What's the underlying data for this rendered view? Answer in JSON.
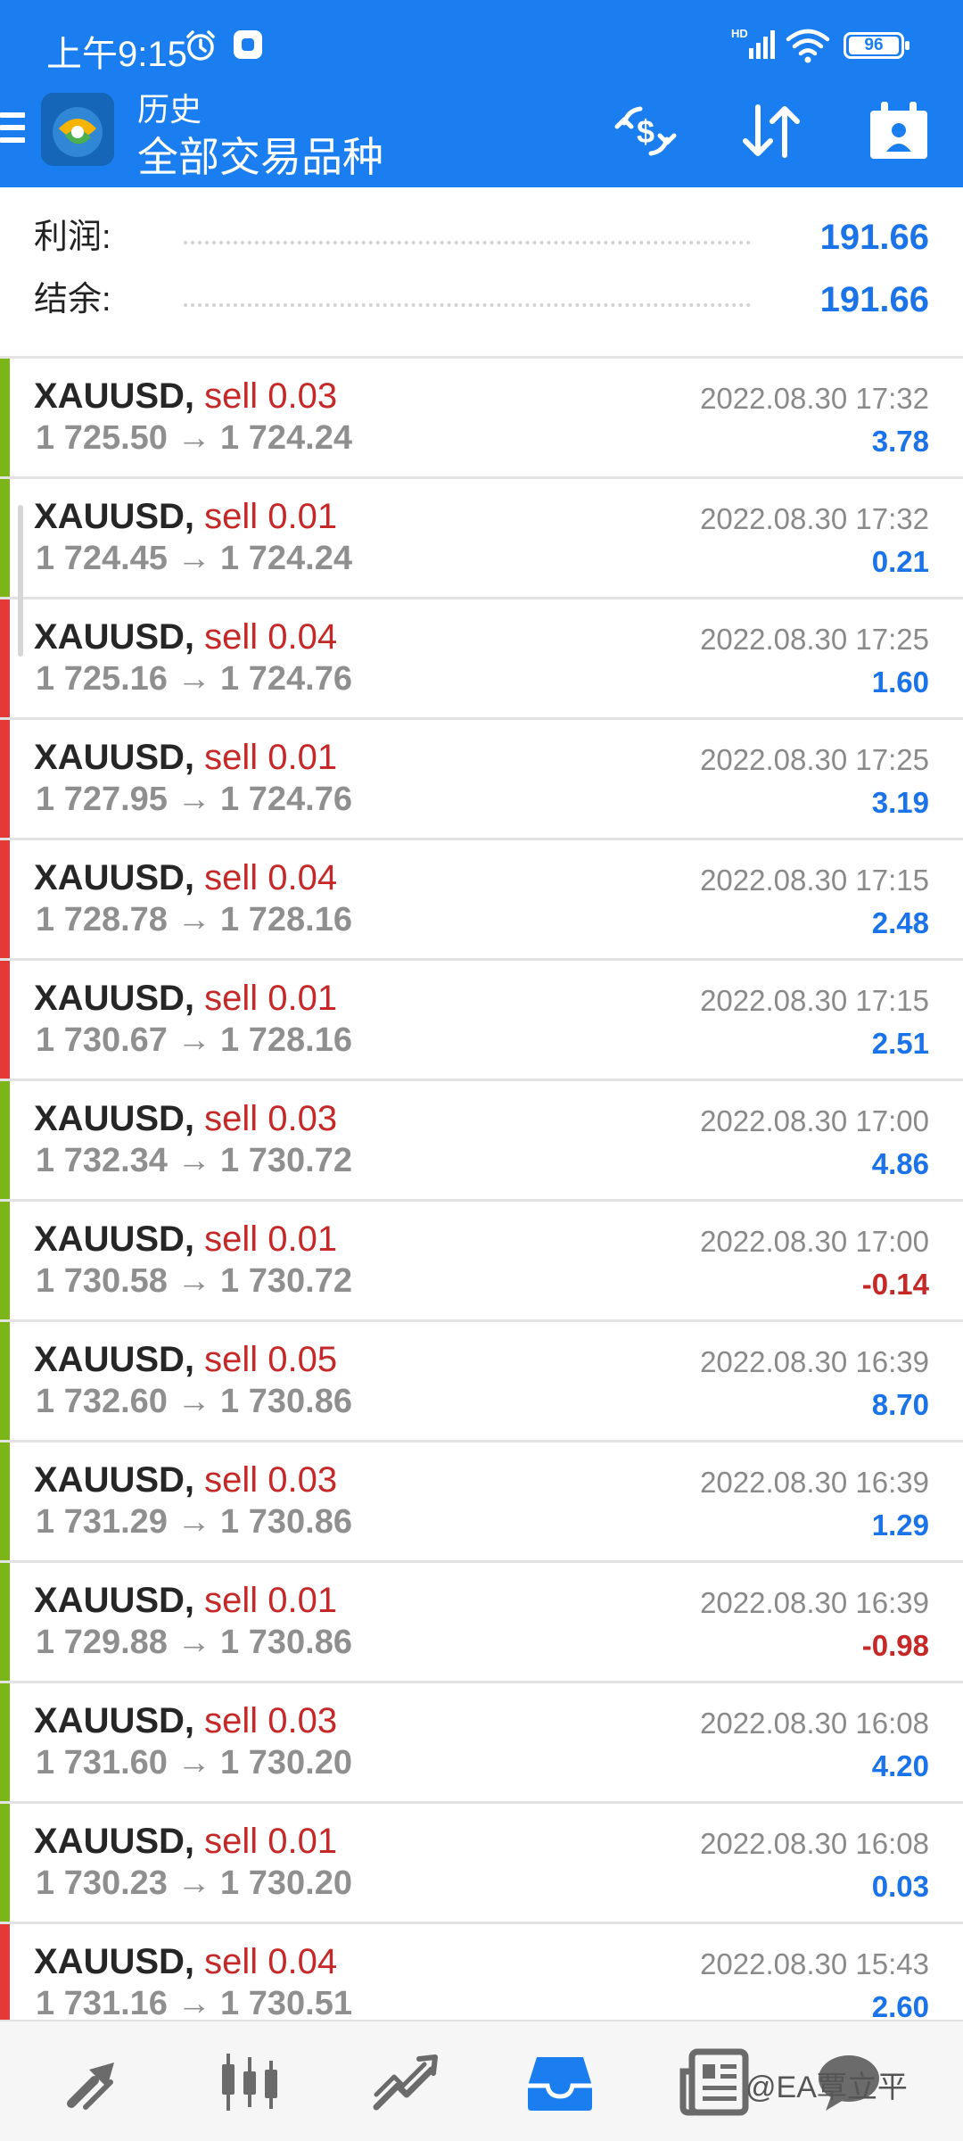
{
  "status_bar": {
    "time": "上午9:15",
    "network": "HD",
    "battery": "96"
  },
  "app_bar": {
    "title_small": "历史",
    "title_big": "全部交易品种",
    "icons": [
      "menu-icon",
      "app-logo",
      "currency-exchange-icon",
      "sort-icon",
      "calendar-icon"
    ]
  },
  "summary": {
    "profit_label": "利润:",
    "profit_value": "191.66",
    "balance_label": "结余:",
    "balance_value": "191.66"
  },
  "colors": {
    "header": "#1a7ef0",
    "positive": "#1a73e8",
    "negative": "#c62828",
    "sell": "#c62828",
    "bar_green": "#7cb518",
    "bar_red": "#e53935"
  },
  "trades": [
    {
      "symbol": "XAUUSD,",
      "side": "sell 0.03",
      "open": "1 725.50",
      "arrow": "→",
      "close": "1 724.24",
      "time": "2022.08.30 17:32",
      "profit": "3.78",
      "bar": "green",
      "negative": false
    },
    {
      "symbol": "XAUUSD,",
      "side": "sell 0.01",
      "open": "1 724.45",
      "arrow": "→",
      "close": "1 724.24",
      "time": "2022.08.30 17:32",
      "profit": "0.21",
      "bar": "green",
      "negative": false
    },
    {
      "symbol": "XAUUSD,",
      "side": "sell 0.04",
      "open": "1 725.16",
      "arrow": "→",
      "close": "1 724.76",
      "time": "2022.08.30 17:25",
      "profit": "1.60",
      "bar": "red",
      "negative": false
    },
    {
      "symbol": "XAUUSD,",
      "side": "sell 0.01",
      "open": "1 727.95",
      "arrow": "→",
      "close": "1 724.76",
      "time": "2022.08.30 17:25",
      "profit": "3.19",
      "bar": "red",
      "negative": false
    },
    {
      "symbol": "XAUUSD,",
      "side": "sell 0.04",
      "open": "1 728.78",
      "arrow": "→",
      "close": "1 728.16",
      "time": "2022.08.30 17:15",
      "profit": "2.48",
      "bar": "red",
      "negative": false
    },
    {
      "symbol": "XAUUSD,",
      "side": "sell 0.01",
      "open": "1 730.67",
      "arrow": "→",
      "close": "1 728.16",
      "time": "2022.08.30 17:15",
      "profit": "2.51",
      "bar": "red",
      "negative": false
    },
    {
      "symbol": "XAUUSD,",
      "side": "sell 0.03",
      "open": "1 732.34",
      "arrow": "→",
      "close": "1 730.72",
      "time": "2022.08.30 17:00",
      "profit": "4.86",
      "bar": "green",
      "negative": false
    },
    {
      "symbol": "XAUUSD,",
      "side": "sell 0.01",
      "open": "1 730.58",
      "arrow": "→",
      "close": "1 730.72",
      "time": "2022.08.30 17:00",
      "profit": "-0.14",
      "bar": "green",
      "negative": true
    },
    {
      "symbol": "XAUUSD,",
      "side": "sell 0.05",
      "open": "1 732.60",
      "arrow": "→",
      "close": "1 730.86",
      "time": "2022.08.30 16:39",
      "profit": "8.70",
      "bar": "green",
      "negative": false
    },
    {
      "symbol": "XAUUSD,",
      "side": "sell 0.03",
      "open": "1 731.29",
      "arrow": "→",
      "close": "1 730.86",
      "time": "2022.08.30 16:39",
      "profit": "1.29",
      "bar": "green",
      "negative": false
    },
    {
      "symbol": "XAUUSD,",
      "side": "sell 0.01",
      "open": "1 729.88",
      "arrow": "→",
      "close": "1 730.86",
      "time": "2022.08.30 16:39",
      "profit": "-0.98",
      "bar": "green",
      "negative": true
    },
    {
      "symbol": "XAUUSD,",
      "side": "sell 0.03",
      "open": "1 731.60",
      "arrow": "→",
      "close": "1 730.20",
      "time": "2022.08.30 16:08",
      "profit": "4.20",
      "bar": "green",
      "negative": false
    },
    {
      "symbol": "XAUUSD,",
      "side": "sell 0.01",
      "open": "1 730.23",
      "arrow": "→",
      "close": "1 730.20",
      "time": "2022.08.30 16:08",
      "profit": "0.03",
      "bar": "green",
      "negative": false
    },
    {
      "symbol": "XAUUSD,",
      "side": "sell 0.04",
      "open": "1 731.16",
      "arrow": "→",
      "close": "1 730.51",
      "time": "2022.08.30 15:43",
      "profit": "2.60",
      "bar": "red",
      "negative": false
    }
  ],
  "bottom_nav": {
    "items": [
      "quotes-icon",
      "chart-icon",
      "trade-icon",
      "history-icon",
      "news-icon",
      "chat-icon"
    ],
    "active": "history-icon",
    "watermark": "@EA覃立平"
  }
}
